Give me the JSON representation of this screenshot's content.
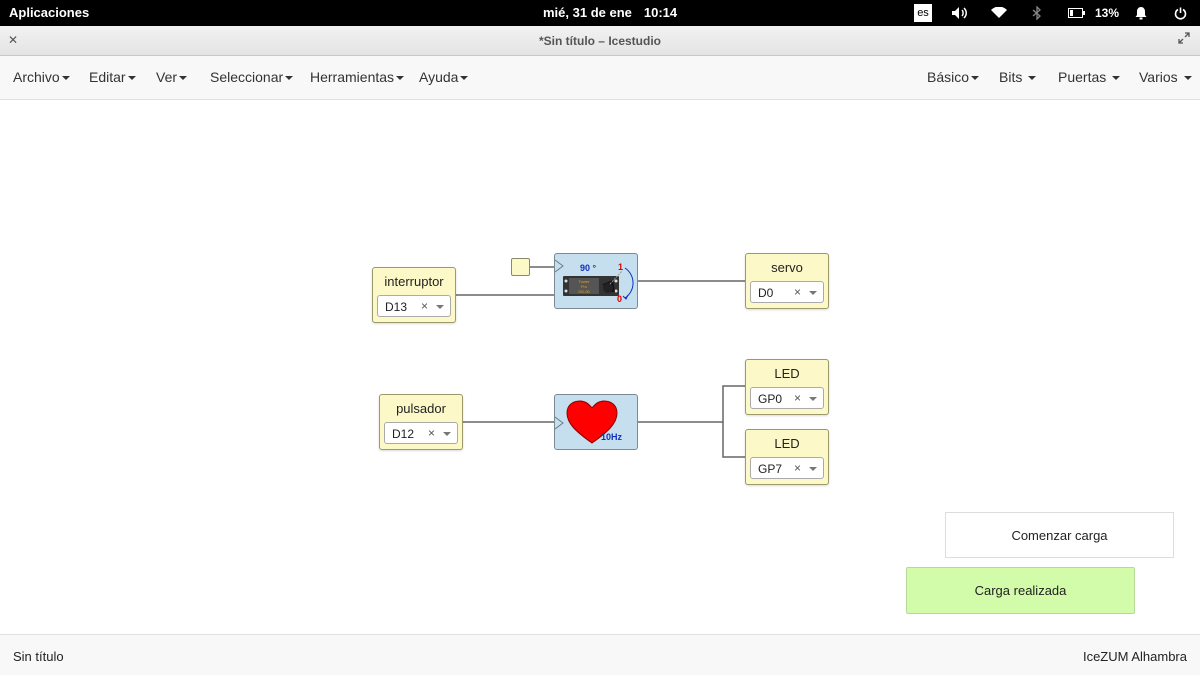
{
  "system_bar": {
    "apps_label": "Aplicaciones",
    "date": "mié, 31 de ene",
    "time": "10:14",
    "keyboard_layout": "es",
    "battery": "13%",
    "icons": [
      "volume-icon",
      "wifi-icon",
      "bluetooth-icon",
      "battery-icon",
      "notifications-icon",
      "power-icon"
    ]
  },
  "window": {
    "title": "*Sin título – Icestudio"
  },
  "menubar": {
    "left": [
      "Archivo",
      "Editar",
      "Ver",
      "Seleccionar",
      "Herramientas",
      "Ayuda"
    ],
    "right": [
      "Básico",
      "Bits",
      "Puertas",
      "Varios"
    ]
  },
  "canvas": {
    "blocks": {
      "interruptor": {
        "label": "interruptor",
        "pin": "D13"
      },
      "servo": {
        "label": "servo",
        "pin": "D0"
      },
      "pulsador": {
        "label": "pulsador",
        "pin": "D12"
      },
      "led1": {
        "label": "LED",
        "pin": "GP0"
      },
      "led2": {
        "label": "LED",
        "pin": "GP7"
      }
    },
    "servo_block": {
      "angle": "90 °",
      "mark_high": "1",
      "mark_low": "0",
      "chip_text": [
        "Tower",
        "Pro",
        "SG-90"
      ]
    },
    "heart_block": {
      "freq": "10Hz"
    }
  },
  "buttons": {
    "start": "Comenzar carga",
    "done": "Carga realizada"
  },
  "status": {
    "left": "Sin título",
    "right": "IceZUM Alhambra"
  },
  "colors": {
    "io_block": "#fdf8c8",
    "logic_block": "#c6dfee",
    "done_button": "#d3fcaa",
    "heart": "#ff0000"
  }
}
